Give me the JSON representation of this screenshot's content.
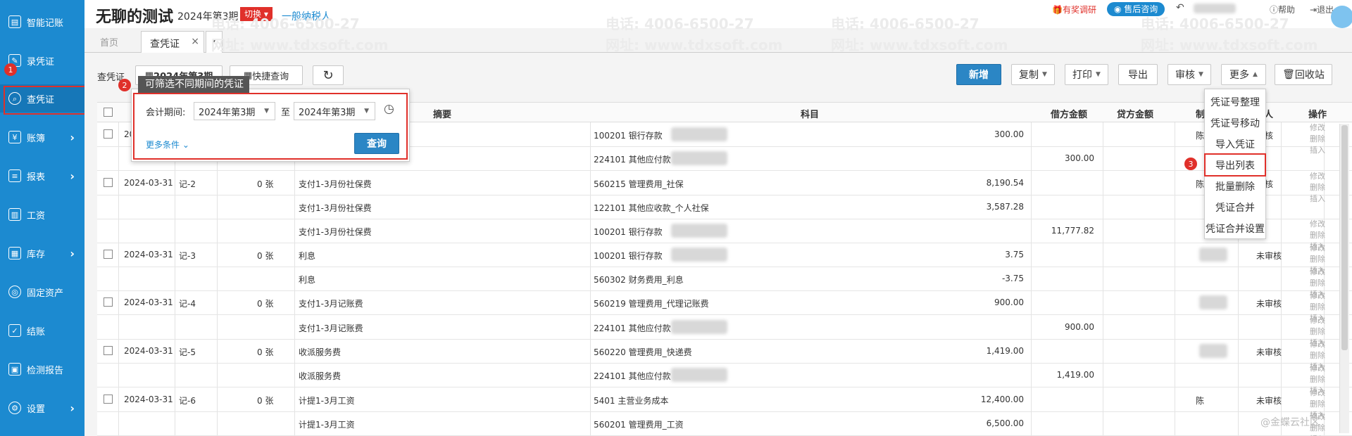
{
  "sidebar": {
    "items": [
      {
        "label": "智能记账",
        "icon": "smart-book-icon",
        "arrow": ""
      },
      {
        "label": "录凭证",
        "icon": "enter-voucher-icon",
        "arrow": ""
      },
      {
        "label": "查凭证",
        "icon": "search-icon",
        "arrow": ""
      },
      {
        "label": "账簿",
        "icon": "ledger-icon",
        "arrow": "›"
      },
      {
        "label": "报表",
        "icon": "report-icon",
        "arrow": "›"
      },
      {
        "label": "工资",
        "icon": "salary-icon",
        "arrow": ""
      },
      {
        "label": "库存",
        "icon": "inventory-icon",
        "arrow": "›"
      },
      {
        "label": "固定资产",
        "icon": "fixed-asset-icon",
        "arrow": ""
      },
      {
        "label": "结账",
        "icon": "close-books-icon",
        "arrow": ""
      },
      {
        "label": "检测报告",
        "icon": "check-report-icon",
        "arrow": ""
      },
      {
        "label": "设置",
        "icon": "gear-icon",
        "arrow": "›"
      }
    ],
    "badge1": "1"
  },
  "header": {
    "company": "无聊的测试",
    "period": "2024年第3期",
    "switch_label": "切换",
    "taxpayer": "一般纳税人",
    "reward_label": "有奖调研",
    "service_label": "售后咨询",
    "help_label": "帮助",
    "exit_label": "退出"
  },
  "tabs": {
    "home": "首页",
    "active": "查凭证",
    "close": "×",
    "more": "▾"
  },
  "toolbar": {
    "label": "查凭证",
    "period_btn": "2024年第3期",
    "quick_query": "快捷查询",
    "refresh": "↻",
    "new": "新增",
    "copy": "复制",
    "print": "打印",
    "export": "导出",
    "audit": "审核",
    "more": "更多",
    "recycle": "回收站"
  },
  "tooltip2": {
    "badge": "2",
    "text": "可筛选不同期间的凭证"
  },
  "filter": {
    "label": "会计期间:",
    "from": "2024年第3期",
    "to_label": "至",
    "to": "2024年第3期",
    "more_conditions": "更多条件",
    "query": "查询"
  },
  "more_menu": {
    "badge3": "3",
    "items": [
      "凭证号整理",
      "凭证号移动",
      "导入凭证",
      "导出列表",
      "批量删除",
      "凭证合并",
      "凭证合并设置"
    ]
  },
  "table": {
    "headers": {
      "summary": "摘要",
      "subject": "科目",
      "debit": "借方金额",
      "credit": "贷方金额",
      "maker": "制",
      "auditor": "核人",
      "ops": "操作"
    },
    "rows": [
      {
        "date": "20",
        "no": "",
        "att": "",
        "summary": "",
        "subject": "100201 银行存款",
        "debit": "300.00",
        "credit": "",
        "maker": "陈",
        "status": "审核"
      },
      {
        "date": "",
        "no": "",
        "att": "",
        "summary": "",
        "subject": "224101 其他应付款",
        "debit": "",
        "credit": "300.00",
        "maker": "",
        "status": ""
      },
      {
        "date": "2024-03-31",
        "no": "记-2",
        "att": "0 张",
        "summary": "支付1-3月份社保费",
        "subject": "560215 管理费用_社保",
        "debit": "8,190.54",
        "credit": "",
        "maker": "陈",
        "status": "审核"
      },
      {
        "date": "",
        "no": "",
        "att": "",
        "summary": "支付1-3月份社保费",
        "subject": "122101 其他应收款_个人社保",
        "debit": "3,587.28",
        "credit": "",
        "maker": "",
        "status": ""
      },
      {
        "date": "",
        "no": "",
        "att": "",
        "summary": "支付1-3月份社保费",
        "subject": "100201 银行存款",
        "debit": "",
        "credit": "11,777.82",
        "maker": "",
        "status": ""
      },
      {
        "date": "2024-03-31",
        "no": "记-3",
        "att": "0 张",
        "summary": "利息",
        "subject": "100201 银行存款",
        "debit": "3.75",
        "credit": "",
        "maker": "",
        "status": "未审核"
      },
      {
        "date": "",
        "no": "",
        "att": "",
        "summary": "利息",
        "subject": "560302 财务费用_利息",
        "debit": "-3.75",
        "credit": "",
        "maker": "",
        "status": ""
      },
      {
        "date": "2024-03-31",
        "no": "记-4",
        "att": "0 张",
        "summary": "支付1-3月记账费",
        "subject": "560219 管理费用_代理记账费",
        "debit": "900.00",
        "credit": "",
        "maker": "",
        "status": "未审核"
      },
      {
        "date": "",
        "no": "",
        "att": "",
        "summary": "支付1-3月记账费",
        "subject": "224101 其他应付款",
        "debit": "",
        "credit": "900.00",
        "maker": "",
        "status": ""
      },
      {
        "date": "2024-03-31",
        "no": "记-5",
        "att": "0 张",
        "summary": "收派服务费",
        "subject": "560220 管理费用_快递费",
        "debit": "1,419.00",
        "credit": "",
        "maker": "",
        "status": "未审核"
      },
      {
        "date": "",
        "no": "",
        "att": "",
        "summary": "收派服务费",
        "subject": "224101 其他应付款",
        "debit": "",
        "credit": "1,419.00",
        "maker": "",
        "status": ""
      },
      {
        "date": "2024-03-31",
        "no": "记-6",
        "att": "0 张",
        "summary": "计提1-3月工资",
        "subject": "5401 主营业务成本",
        "debit": "12,400.00",
        "credit": "",
        "maker": "陈",
        "status": "未审核"
      },
      {
        "date": "",
        "no": "",
        "att": "",
        "summary": "计提1-3月工资",
        "subject": "560201 管理费用_工资",
        "debit": "6,500.00",
        "credit": "",
        "maker": "",
        "status": ""
      }
    ],
    "ops": [
      "修改",
      "删除",
      "插入"
    ]
  },
  "watermark": {
    "phone": "电话: 4006-6500-27",
    "site": "网址: www.tdxsoft.com",
    "footer": "@金蝶云社区"
  },
  "colors": {
    "sidebar": "#1c8ad0",
    "primary": "#2b86c5",
    "highlight": "#e0302a"
  }
}
